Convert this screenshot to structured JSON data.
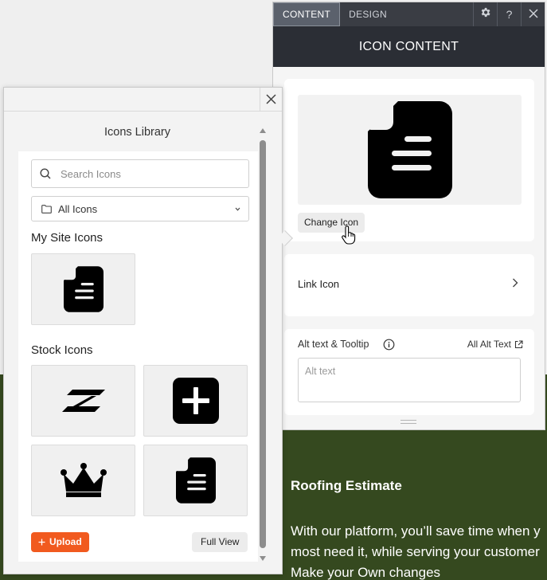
{
  "website": {
    "heading": "Roofing Estimate",
    "paragraph_lines": [
      "With our platform, you’ll save time when y",
      "most need it, while serving your customer",
      "Make your Own changes"
    ]
  },
  "panel": {
    "tabs": [
      {
        "label": "CONTENT",
        "active": true
      },
      {
        "label": "DESIGN",
        "active": false
      }
    ],
    "help_label": "?",
    "title": "ICON CONTENT",
    "change_icon_label": "Change Icon",
    "link_icon_label": "Link Icon",
    "alt_text_label": "Alt text & Tooltip",
    "all_alt_text_label": "All Alt Text",
    "alt_text_placeholder": "Alt text",
    "preview_icon": "document-icon"
  },
  "library": {
    "title": "Icons Library",
    "search_placeholder": "Search Icons",
    "category_selected": "All Icons",
    "my_site_heading": "My Site Icons",
    "my_site_icons": [
      "document-icon"
    ],
    "stock_heading": "Stock Icons",
    "stock_icons": [
      "z-arrows-icon",
      "plus-square-icon",
      "crown-icon",
      "document-icon"
    ],
    "upload_label": "Upload",
    "full_view_label": "Full View"
  },
  "colors": {
    "accent_orange": "#f15a1f",
    "panel_dark": "#2b2e35",
    "site_green": "#35491f"
  }
}
